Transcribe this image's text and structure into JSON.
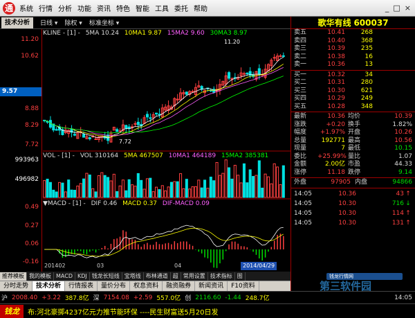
{
  "menubar": {
    "logo": "通",
    "items": [
      "系统",
      "行情",
      "分析",
      "功能",
      "资讯",
      "特色",
      "智能",
      "工具",
      "委托",
      "帮助"
    ],
    "window_buttons": [
      "_",
      "□",
      "×"
    ]
  },
  "toolbar": {
    "tab": "技术分析",
    "period": "日线",
    "adjust": "除权",
    "coord": "标准坐标",
    "icons": [
      "⊕",
      "锁",
      "◐",
      "刷",
      "ℹ",
      "⬚"
    ]
  },
  "kline": {
    "header": {
      "name": "KLINE - [1] -",
      "ma5": "5MA 10.24",
      "ma10": "10MA1 9.87",
      "ma15": "15MA2 9.60",
      "ma30": "30MA3 8.97"
    },
    "scale": [
      "11.20",
      "10.62",
      "9.57",
      "8.88",
      "8.29",
      "7.72"
    ],
    "current_marker": "9.57",
    "high_label": "11.20",
    "low_label": "7.72"
  },
  "volume": {
    "header": {
      "name": "VOL - [1] -",
      "vol": "VOL 310164",
      "ma5": "5MA 467507",
      "ma10": "10MA1 464189",
      "ma15": "15MA2 385381"
    },
    "scale": [
      "993963",
      "496982"
    ]
  },
  "macd": {
    "header": {
      "name": "▼MACD - [1] -",
      "dif": "DIF 0.46",
      "macd": "MACD 0.37",
      "difmacd": "DIF-MACD 0.09"
    },
    "scale": [
      "0.49",
      "0.27",
      "0.06",
      "-0.16"
    ]
  },
  "date_axis": {
    "labels": [
      "201402",
      "03",
      "04"
    ],
    "cursor_date": "2014/04/29"
  },
  "bottom_tabs": [
    "推荐模板",
    "我的模板",
    "MACD",
    "KDJ",
    "钱龙长短线",
    "宝塔线",
    "布林通道",
    "超",
    "常用设置",
    "技术指标",
    "图"
  ],
  "big_tabs": {
    "items": [
      "分时走势",
      "技术分析",
      "行情报表",
      "量价分布",
      "权息资料",
      "融资融券",
      "新闻资讯",
      "F10资料"
    ],
    "active": 1
  },
  "index_bar": {
    "sh_label": "沪",
    "sh_val": "2008.40",
    "sh_chg": "+3.22",
    "sh_amt": "387.8亿",
    "sz_label": "深",
    "sz_val": "7154.08",
    "sz_chg": "+2.59",
    "sz_amt": "557.0亿",
    "c_label": "创",
    "c_val": "2116.60",
    "c_chg": "-1.44",
    "c_amt": "248.7亿",
    "time": "14:05"
  },
  "ticker": {
    "logo": "钱龙",
    "text": "布:河北豪掷4237亿元力推节能环保  ----民生财富送5月20日发"
  },
  "quote": {
    "name": "歌华有线",
    "code": "600037",
    "asks": [
      {
        "label": "卖五",
        "price": "10.41",
        "vol": "268"
      },
      {
        "label": "卖四",
        "price": "10.40",
        "vol": "368"
      },
      {
        "label": "卖三",
        "price": "10.39",
        "vol": "235"
      },
      {
        "label": "卖二",
        "price": "10.38",
        "vol": "16"
      },
      {
        "label": "卖一",
        "price": "10.36",
        "vol": "13"
      }
    ],
    "bids": [
      {
        "label": "买一",
        "price": "10.32",
        "vol": "34"
      },
      {
        "label": "买二",
        "price": "10.31",
        "vol": "280"
      },
      {
        "label": "买三",
        "price": "10.30",
        "vol": "621"
      },
      {
        "label": "买四",
        "price": "10.29",
        "vol": "249"
      },
      {
        "label": "买五",
        "price": "10.28",
        "vol": "348"
      }
    ],
    "stats": [
      {
        "k1": "最新",
        "v1": "10.36",
        "k2": "均价",
        "v2": "10.39",
        "c1": "r",
        "c2": "r"
      },
      {
        "k1": "涨跌",
        "v1": "+0.20",
        "k2": "换手",
        "v2": "1.82%",
        "c1": "r",
        "c2": "w"
      },
      {
        "k1": "幅度",
        "v1": "+1.97%",
        "k2": "开盘",
        "v2": "10.26",
        "c1": "r",
        "c2": "r"
      },
      {
        "k1": "总量",
        "v1": "192771",
        "k2": "最高",
        "v2": "10.56",
        "c1": "y",
        "c2": "r"
      },
      {
        "k1": "现量",
        "v1": "7",
        "k2": "最低",
        "v2": "10.15",
        "c1": "y",
        "c2": "g"
      },
      {
        "k1": "委比",
        "v1": "+25.99%",
        "k2": "量比",
        "v2": "1.07",
        "c1": "r",
        "c2": "w"
      },
      {
        "k1": "金额",
        "v1": "2.00亿",
        "k2": "市盈",
        "v2": "44.33",
        "c1": "y",
        "c2": "w"
      },
      {
        "k1": "涨停",
        "v1": "11.18",
        "k2": "跌停",
        "v2": "9.14",
        "c1": "r",
        "c2": "g"
      }
    ],
    "outer_label": "外盘",
    "outer": "97905",
    "inner_label": "内盘",
    "inner": "94866",
    "ticks": [
      {
        "t": "14:05",
        "p": "10.36",
        "v": "43",
        "d": "↑",
        "c": "r"
      },
      {
        "t": "14:05",
        "p": "10.30",
        "v": "716",
        "d": "↓",
        "c": "g"
      },
      {
        "t": "14:05",
        "p": "10.30",
        "v": "114",
        "d": "↑",
        "c": "r"
      },
      {
        "t": "14:05",
        "p": "10.30",
        "v": "131",
        "d": "↑",
        "c": "r"
      }
    ],
    "hint": "钱龙行情网"
  },
  "watermark": "第三软件园",
  "colors": {
    "up": "#ff4040",
    "down": "#00e0e0",
    "ma5": "#ffffff",
    "ma10": "#ffff00",
    "ma15": "#ff60ff",
    "ma30": "#00ff00",
    "border": "#a00000"
  }
}
